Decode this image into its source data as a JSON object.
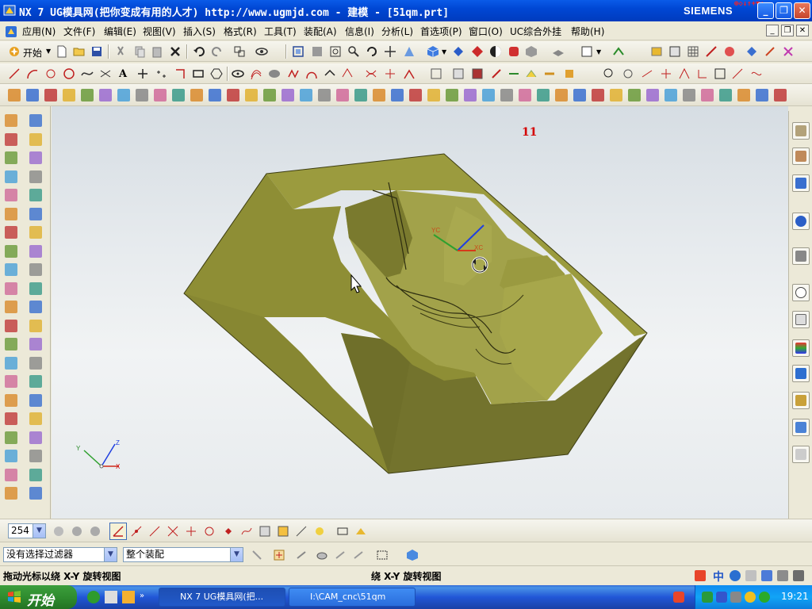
{
  "window": {
    "title": "NX 7 UG模具网(把你变成有用的人才) http://www.ugmjd.com - 建模 - [51qm.prt]",
    "brand": "SIEMENS",
    "watermark_mark": "⊕◇↓↑+▼◆"
  },
  "menubar": {
    "items": [
      "应用(N)",
      "文件(F)",
      "编辑(E)",
      "视图(V)",
      "插入(S)",
      "格式(R)",
      "工具(T)",
      "装配(A)",
      "信息(I)",
      "分析(L)",
      "首选项(P)",
      "窗口(O)",
      "UC综合外挂",
      "帮助(H)"
    ]
  },
  "toolbar1": {
    "start_label": "开始"
  },
  "graphics": {
    "annotation_label": "11",
    "wcs_labels": {
      "yc": "YC",
      "xc": "XC"
    },
    "abs_axes": {
      "x": "X",
      "y": "Y",
      "z": "Z"
    },
    "body_color": "#8f8f35"
  },
  "bottom_toolbar": {
    "zoom_value": "254"
  },
  "selection_bar": {
    "filter_value": "没有选择过滤器",
    "scope_value": "整个装配"
  },
  "status": {
    "prompt": "拖动光标以绕 X-Y 旋转视图",
    "status": "绕 X-Y 旋转视图"
  },
  "taskbar": {
    "start_label": "开始",
    "tasks": [
      "NX 7 UG模具网(把...",
      "I:\\CAM_cnc\\51qm"
    ],
    "clock": "19:21",
    "ime_label": "中"
  },
  "colors": {
    "titlebar": "#0047d4",
    "taskbar": "#245edb",
    "start_button": "#2f8c2f",
    "annotation": "#d40000"
  }
}
